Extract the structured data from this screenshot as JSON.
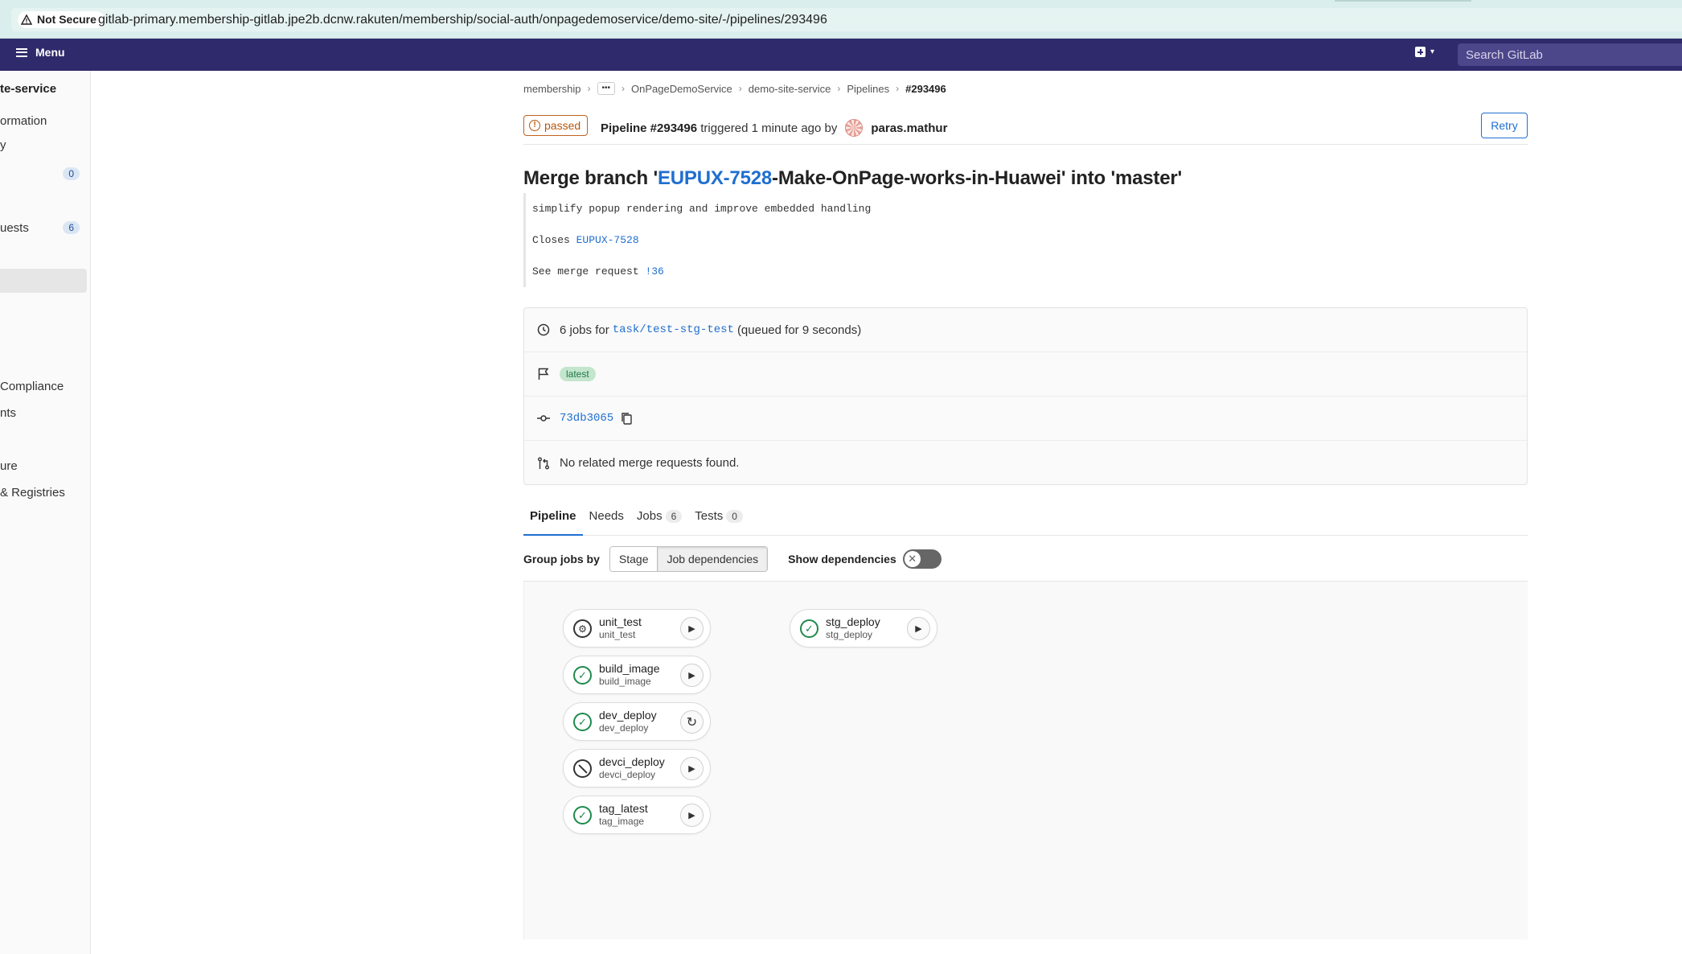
{
  "browser": {
    "security_label": "Not Secure",
    "url": "gitlab-primary.membership-gitlab.jpe2b.dcnw.rakuten/membership/social-auth/onpagedemoservice/demo-site/-/pipelines/293496"
  },
  "topnav": {
    "menu_label": "Menu",
    "search_placeholder": "Search GitLab"
  },
  "sidebar": {
    "items": [
      {
        "label": "te-service"
      },
      {
        "label": "ormation"
      },
      {
        "label": "y"
      },
      {
        "label": "",
        "badge": "0"
      },
      {
        "label": "uests",
        "badge": "6"
      },
      {
        "label": " Compliance"
      },
      {
        "label": "nts"
      },
      {
        "label": "ure"
      },
      {
        "label": "& Registries"
      }
    ]
  },
  "breadcrumb": {
    "items": [
      "membership",
      "OnPageDemoService",
      "demo-site-service",
      "Pipelines"
    ],
    "current": "#293496"
  },
  "header": {
    "status": "passed",
    "pipeline_label": "Pipeline #293496",
    "triggered_text": "triggered 1 minute ago by",
    "user": "paras.mathur",
    "retry_label": "Retry"
  },
  "title": {
    "prefix": "Merge branch '",
    "issue_link": "EUPUX-7528",
    "suffix": "-Make-OnPage-works-in-Huawei' into 'master'"
  },
  "commit_message": {
    "line1": "simplify popup rendering and improve embedded handling",
    "closes_prefix": "Closes ",
    "closes_link": "EUPUX-7528",
    "see_prefix": "See merge request ",
    "see_link": "!36"
  },
  "info": {
    "jobs_prefix": "6 jobs for",
    "branch": "task/test-stg-test",
    "jobs_suffix": "(queued for 9 seconds)",
    "badge": "latest",
    "commit_sha": "73db3065",
    "mr_text": "No related merge requests found."
  },
  "tabs": [
    {
      "label": "Pipeline"
    },
    {
      "label": "Needs"
    },
    {
      "label": "Jobs",
      "count": "6"
    },
    {
      "label": "Tests",
      "count": "0"
    }
  ],
  "grouping": {
    "label": "Group jobs by",
    "options": [
      "Stage",
      "Job dependencies"
    ],
    "selected": "Job dependencies",
    "show_deps_label": "Show dependencies",
    "show_deps_on": false
  },
  "jobs": [
    {
      "name": "unit_test",
      "sub": "unit_test",
      "status": "manual",
      "action": "play"
    },
    {
      "name": "build_image",
      "sub": "build_image",
      "status": "success",
      "action": "play"
    },
    {
      "name": "dev_deploy",
      "sub": "dev_deploy",
      "status": "success",
      "action": "retry"
    },
    {
      "name": "devci_deploy",
      "sub": "devci_deploy",
      "status": "skipped",
      "action": "play"
    },
    {
      "name": "tag_latest",
      "sub": "tag_image",
      "status": "success",
      "action": "play"
    },
    {
      "name": "stg_deploy",
      "sub": "stg_deploy",
      "status": "success",
      "action": "play"
    }
  ],
  "colors": {
    "nav_bg": "#2f2a6b",
    "link": "#1f6fd0",
    "passed": "#b5560b",
    "success": "#1d8a4c"
  }
}
